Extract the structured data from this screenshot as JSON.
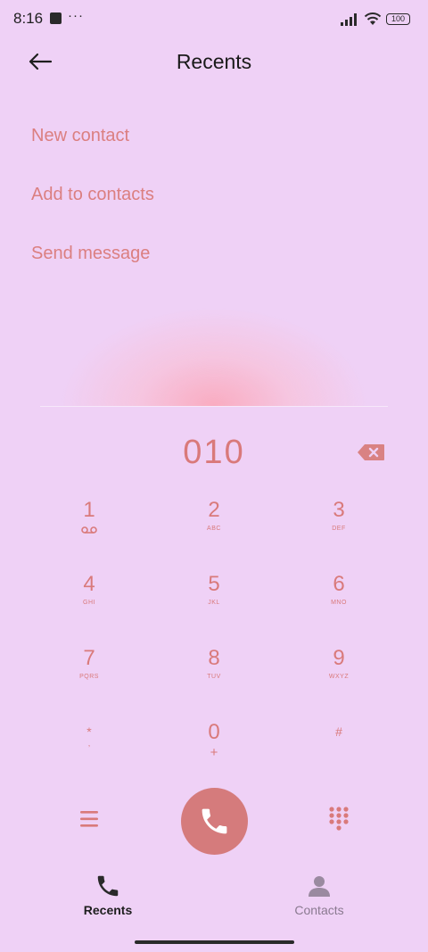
{
  "status_bar": {
    "time": "8:16",
    "dots": "···",
    "battery": "100"
  },
  "header": {
    "title": "Recents",
    "back_icon": "arrow-left-icon"
  },
  "actions": [
    {
      "label": "New contact"
    },
    {
      "label": "Add to contacts"
    },
    {
      "label": "Send message"
    }
  ],
  "dialed_number": "010",
  "keypad": [
    {
      "digit": "1",
      "letters": ""
    },
    {
      "digit": "2",
      "letters": "ABC"
    },
    {
      "digit": "3",
      "letters": "DEF"
    },
    {
      "digit": "4",
      "letters": "GHI"
    },
    {
      "digit": "5",
      "letters": "JKL"
    },
    {
      "digit": "6",
      "letters": "MNO"
    },
    {
      "digit": "7",
      "letters": "PQRS"
    },
    {
      "digit": "8",
      "letters": "TUV"
    },
    {
      "digit": "9",
      "letters": "WXYZ"
    },
    {
      "digit": "*",
      "letters": ","
    },
    {
      "digit": "0",
      "letters": "+"
    },
    {
      "digit": "#",
      "letters": ""
    }
  ],
  "nav": {
    "recents_label": "Recents",
    "contacts_label": "Contacts"
  },
  "colors": {
    "background": "#efd1f6",
    "accent": "#d97a7b",
    "call_button": "#d57b7c"
  }
}
